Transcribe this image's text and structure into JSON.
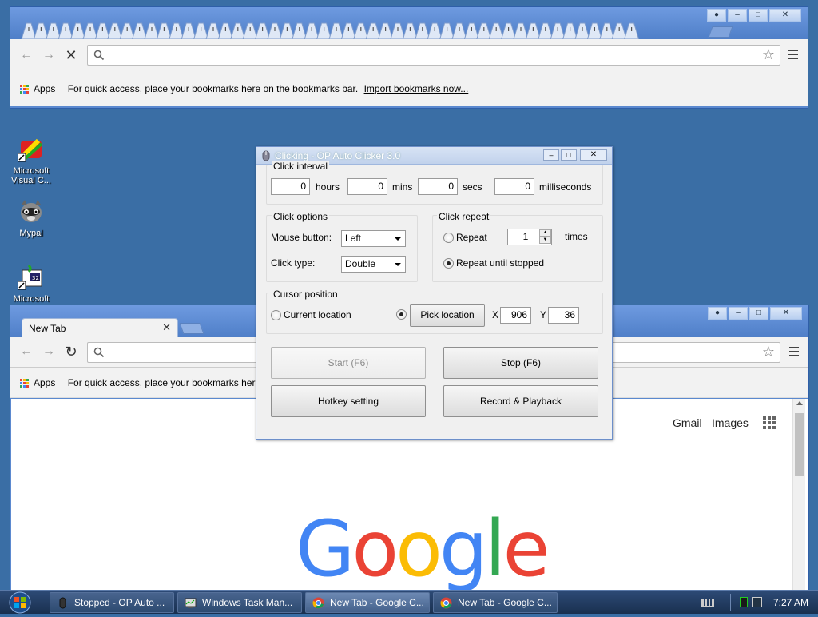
{
  "desktop": {
    "icons": [
      {
        "label": "Microsoft Visual C...",
        "icon": "visual-c-icon"
      },
      {
        "label": "Mypal",
        "icon": "raccoon-icon"
      },
      {
        "label": "Microsoft",
        "icon": "microsoft-installer-icon"
      }
    ]
  },
  "chrome_back": {
    "omnibox_value": "",
    "bookmarks": {
      "apps": "Apps",
      "hint": "For quick access, place your bookmarks here on the bookmarks bar.",
      "import": "Import bookmarks now..."
    }
  },
  "chrome_front": {
    "tab_title": "New Tab",
    "bookmarks": {
      "apps": "Apps",
      "hint": "For quick access, place your bookmarks here o"
    },
    "links": {
      "gmail": "Gmail",
      "images": "Images"
    },
    "logo": "Google"
  },
  "clicker": {
    "title": "Clicking - OP Auto Clicker 3.0",
    "interval": {
      "label": "Click interval",
      "hours": "0",
      "hours_label": "hours",
      "mins": "0",
      "mins_label": "mins",
      "secs": "0",
      "secs_label": "secs",
      "ms": "0",
      "ms_label": "milliseconds"
    },
    "options": {
      "label": "Click options",
      "mouse_button_label": "Mouse button:",
      "mouse_button_value": "Left",
      "click_type_label": "Click type:",
      "click_type_value": "Double"
    },
    "repeat": {
      "label": "Click repeat",
      "repeat_label": "Repeat",
      "repeat_count": "1",
      "times_label": "times",
      "until_stopped_label": "Repeat until stopped",
      "selected": "until_stopped"
    },
    "cursor": {
      "label": "Cursor position",
      "current_label": "Current location",
      "pick_label": "Pick location",
      "x_label": "X",
      "x_value": "906",
      "y_label": "Y",
      "y_value": "36",
      "selected": "pick"
    },
    "buttons": {
      "start": "Start (F6)",
      "stop": "Stop (F6)",
      "hotkey": "Hotkey setting",
      "record": "Record & Playback"
    }
  },
  "taskbar": {
    "tasks": [
      {
        "label": "Stopped - OP Auto ...",
        "icon": "mouse-icon"
      },
      {
        "label": "Windows Task Man...",
        "icon": "task-manager-icon"
      },
      {
        "label": "New Tab - Google C...",
        "icon": "chrome-icon"
      },
      {
        "label": "New Tab - Google C...",
        "icon": "chrome-icon"
      }
    ],
    "clock": "7:27 AM"
  },
  "colors": {
    "desktop": "#3a6ea5",
    "google_blue": "#4285F4",
    "google_red": "#EA4335",
    "google_yellow": "#FBBC05",
    "google_green": "#34A853"
  }
}
